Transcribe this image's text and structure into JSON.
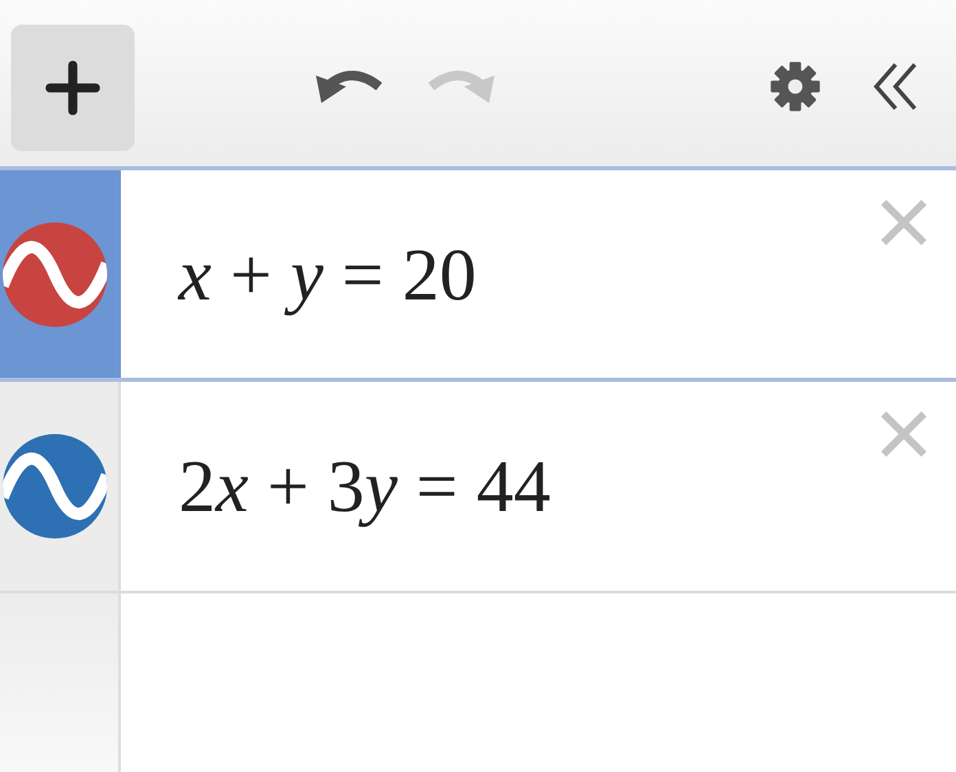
{
  "toolbar": {
    "undo_enabled": true,
    "redo_enabled": false
  },
  "expressions": [
    {
      "parts": [
        {
          "text": "x",
          "italic": true
        },
        {
          "text": " + ",
          "italic": false
        },
        {
          "text": "y",
          "italic": true
        },
        {
          "text": " = 20",
          "italic": false
        }
      ],
      "color": "#c74440",
      "selected": true
    },
    {
      "parts": [
        {
          "text": "2",
          "italic": false
        },
        {
          "text": "x",
          "italic": true
        },
        {
          "text": " + 3",
          "italic": false
        },
        {
          "text": "y",
          "italic": true
        },
        {
          "text": " = 44",
          "italic": false
        }
      ],
      "color": "#2d70b3",
      "selected": false
    }
  ]
}
